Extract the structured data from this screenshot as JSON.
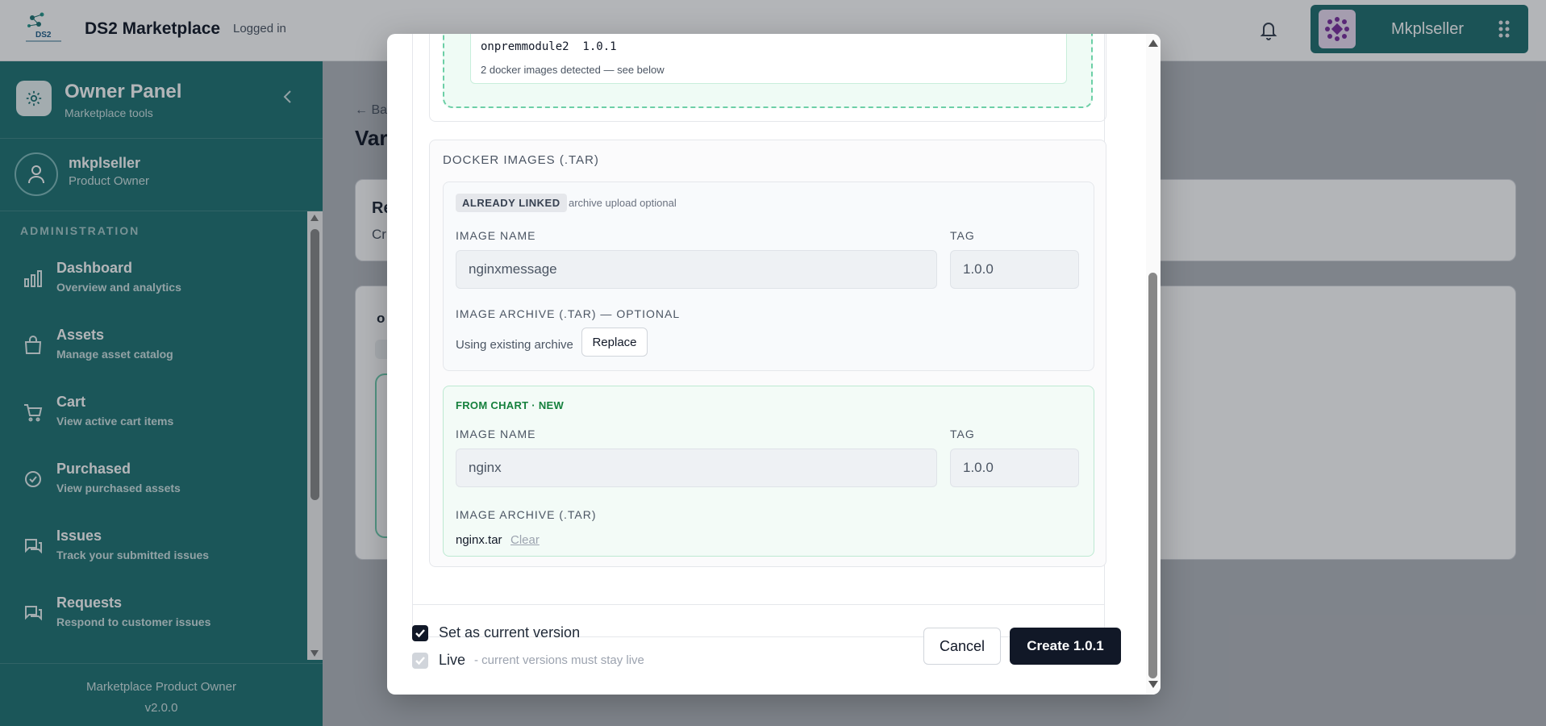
{
  "header": {
    "app_title": "DS2 Marketplace",
    "login_status": "Logged in",
    "logo_icon": "ds2-logo",
    "bell_icon": "bell-icon",
    "user": {
      "name": "Mkplseller",
      "avatar_icon": "purple-pattern-avatar"
    },
    "apps_icon": "grid-dots-icon"
  },
  "sidebar": {
    "panel_title": "Owner Panel",
    "panel_subtitle": "Marketplace tools",
    "profile": {
      "name": "mkplseller",
      "role": "Product Owner"
    },
    "section_label": "ADMINISTRATION",
    "items": [
      {
        "label": "Dashboard",
        "desc": "Overview and analytics",
        "icon": "bar-chart-icon"
      },
      {
        "label": "Assets",
        "desc": "Manage asset catalog",
        "icon": "shopping-bag-icon"
      },
      {
        "label": "Cart",
        "desc": "View active cart items",
        "icon": "cart-icon"
      },
      {
        "label": "Purchased",
        "desc": "View purchased assets",
        "icon": "check-badge-icon"
      },
      {
        "label": "Issues",
        "desc": "Track your submitted issues",
        "icon": "chat-icon"
      },
      {
        "label": "Requests",
        "desc": "Respond to customer issues",
        "icon": "chat-icon"
      }
    ],
    "footer_title": "Marketplace Product Owner",
    "footer_version": "v2.0.0"
  },
  "background_page": {
    "back_text": "← Ba",
    "title_text": "Var",
    "card1_title": "Re",
    "card1_sub": "Cr",
    "card2_title": "o"
  },
  "modal": {
    "detected_module": "onpremmodule2  1.0.1",
    "detected_note": "2 docker images detected — see below",
    "docker_section_title": "DOCKER IMAGES (.TAR)",
    "linked_image": {
      "badge": "ALREADY LINKED",
      "badge_note": "archive upload optional",
      "image_name_label": "IMAGE NAME",
      "image_name_value": "nginxmessage",
      "tag_label": "TAG",
      "tag_value": "1.0.0",
      "archive_label": "IMAGE ARCHIVE (.TAR) — OPTIONAL",
      "archive_status": "Using existing archive",
      "replace_label": "Replace"
    },
    "new_image": {
      "label": "FROM CHART · NEW",
      "image_name_label": "IMAGE NAME",
      "image_name_value": "nginx",
      "tag_label": "TAG",
      "tag_value": "1.0.0",
      "archive_label": "IMAGE ARCHIVE (.TAR)",
      "file_name": "nginx.tar",
      "clear_label": "Clear"
    },
    "set_current_label": "Set as current version",
    "set_current_checked": true,
    "live_label": "Live",
    "live_checked": true,
    "live_note": "- current versions must stay live",
    "cancel_label": "Cancel",
    "create_label": "Create 1.0.1"
  },
  "colors": {
    "sidebar_bg": "#1f7373",
    "accent_green": "#15803d",
    "primary_button": "#111827"
  }
}
